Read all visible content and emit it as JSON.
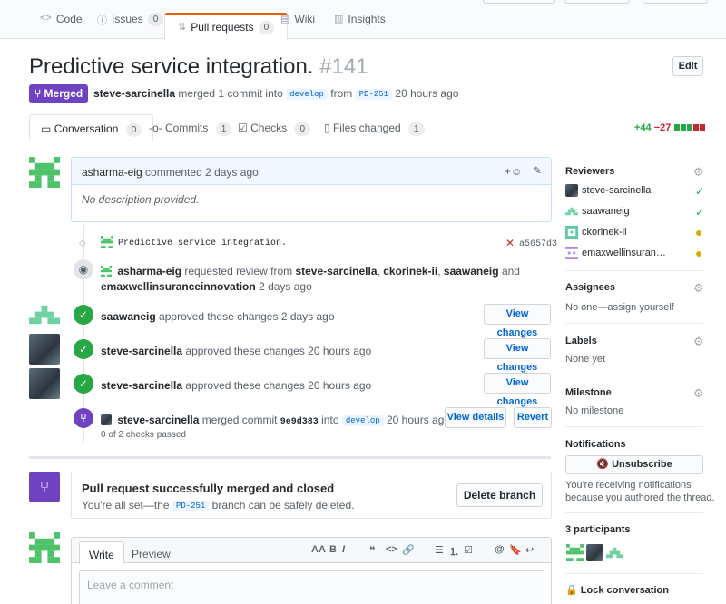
{
  "repo_nav": {
    "tabs": [
      {
        "icon": "code-icon",
        "glyph": "<>",
        "label": "Code",
        "count": ""
      },
      {
        "icon": "issue-icon",
        "glyph": "ⓘ",
        "label": "Issues",
        "count": "0"
      },
      {
        "icon": "pull-request-icon",
        "glyph": "⇅",
        "label": "Pull requests",
        "count": "0"
      },
      {
        "icon": "wiki-icon",
        "glyph": "▤",
        "label": "Wiki",
        "count": ""
      },
      {
        "icon": "graph-icon",
        "glyph": "▥",
        "label": "Insights",
        "count": ""
      }
    ]
  },
  "pr": {
    "title": "Predictive service integration.",
    "number": "#141",
    "edit_label": "Edit",
    "state_label": "Merged",
    "author": "steve-sarcinella",
    "merged_text": "merged 1 commit into",
    "base_branch": "develop",
    "from_text": "from",
    "head_branch": "PD-251",
    "time": "20 hours ago"
  },
  "pr_tabs": [
    {
      "icon": "comment-icon",
      "label": "Conversation",
      "count": "0"
    },
    {
      "icon": "commit-icon",
      "label": "Commits",
      "count": "1"
    },
    {
      "icon": "checklist-icon",
      "label": "Checks",
      "count": "0"
    },
    {
      "icon": "file-diff-icon",
      "label": "Files changed",
      "count": "1"
    }
  ],
  "diffstat": {
    "additions": "+44",
    "deletions": "−27"
  },
  "comment": {
    "author": "asharma-eig",
    "action": "commented 2 days ago",
    "body": "No description provided."
  },
  "commit": {
    "message": "Predictive service integration.",
    "sha": "a5657d3"
  },
  "review_request": {
    "author": "asharma-eig",
    "text1": "requested review from",
    "r1": "steve-sarcinella",
    "r2": "ckorinek-ii",
    "r3": "saawaneig",
    "and": "and",
    "r4": "emaxwellinsuranceinnovation",
    "time": "2 days ago"
  },
  "approvals": [
    {
      "author": "saawaneig",
      "text": "approved these changes 2 days ago",
      "button": "View changes"
    },
    {
      "author": "steve-sarcinella",
      "text": "approved these changes 20 hours ago",
      "button": "View changes"
    },
    {
      "author": "steve-sarcinella",
      "text": "approved these changes 20 hours ago",
      "button": "View changes"
    }
  ],
  "merge_event": {
    "author": "steve-sarcinella",
    "text": "merged commit",
    "sha": "9e9d383",
    "into": "into",
    "branch": "develop",
    "time": "20 hours ago",
    "checks": "0 of 2 checks passed",
    "view_details": "View details",
    "revert": "Revert"
  },
  "merged_box": {
    "title": "Pull request successfully merged and closed",
    "text_before": "You're all set—the",
    "branch": "PD-251",
    "text_after": "branch can be safely deleted.",
    "button": "Delete branch"
  },
  "editor": {
    "write": "Write",
    "preview": "Preview",
    "placeholder": "Leave a comment",
    "tools": [
      "AA",
      "B",
      "I",
      "❝",
      "<>",
      "🔗",
      "☰",
      "⒈",
      "☑",
      "@",
      "🔖",
      "↩"
    ]
  },
  "sidebar": {
    "reviewers_title": "Reviewers",
    "reviewers": [
      {
        "name": "steve-sarcinella",
        "status": "approved"
      },
      {
        "name": "saawaneig",
        "status": "approved"
      },
      {
        "name": "ckorinek-ii",
        "status": "pending"
      },
      {
        "name": "emaxwellinsuran…",
        "status": "pending"
      }
    ],
    "assignees_title": "Assignees",
    "assignees_text": "No one—assign yourself",
    "labels_title": "Labels",
    "labels_text": "None yet",
    "milestone_title": "Milestone",
    "milestone_text": "No milestone",
    "notifications_title": "Notifications",
    "unsubscribe": "Unsubscribe",
    "notif_line1": "You're receiving notifications",
    "notif_line2": "because you authored the thread.",
    "participants": "3 participants",
    "lock": "Lock conversation"
  },
  "colors": {
    "merged": "#6f42c1",
    "approved": "#28a745",
    "pending": "#dbab09",
    "accent": "#e36209"
  }
}
